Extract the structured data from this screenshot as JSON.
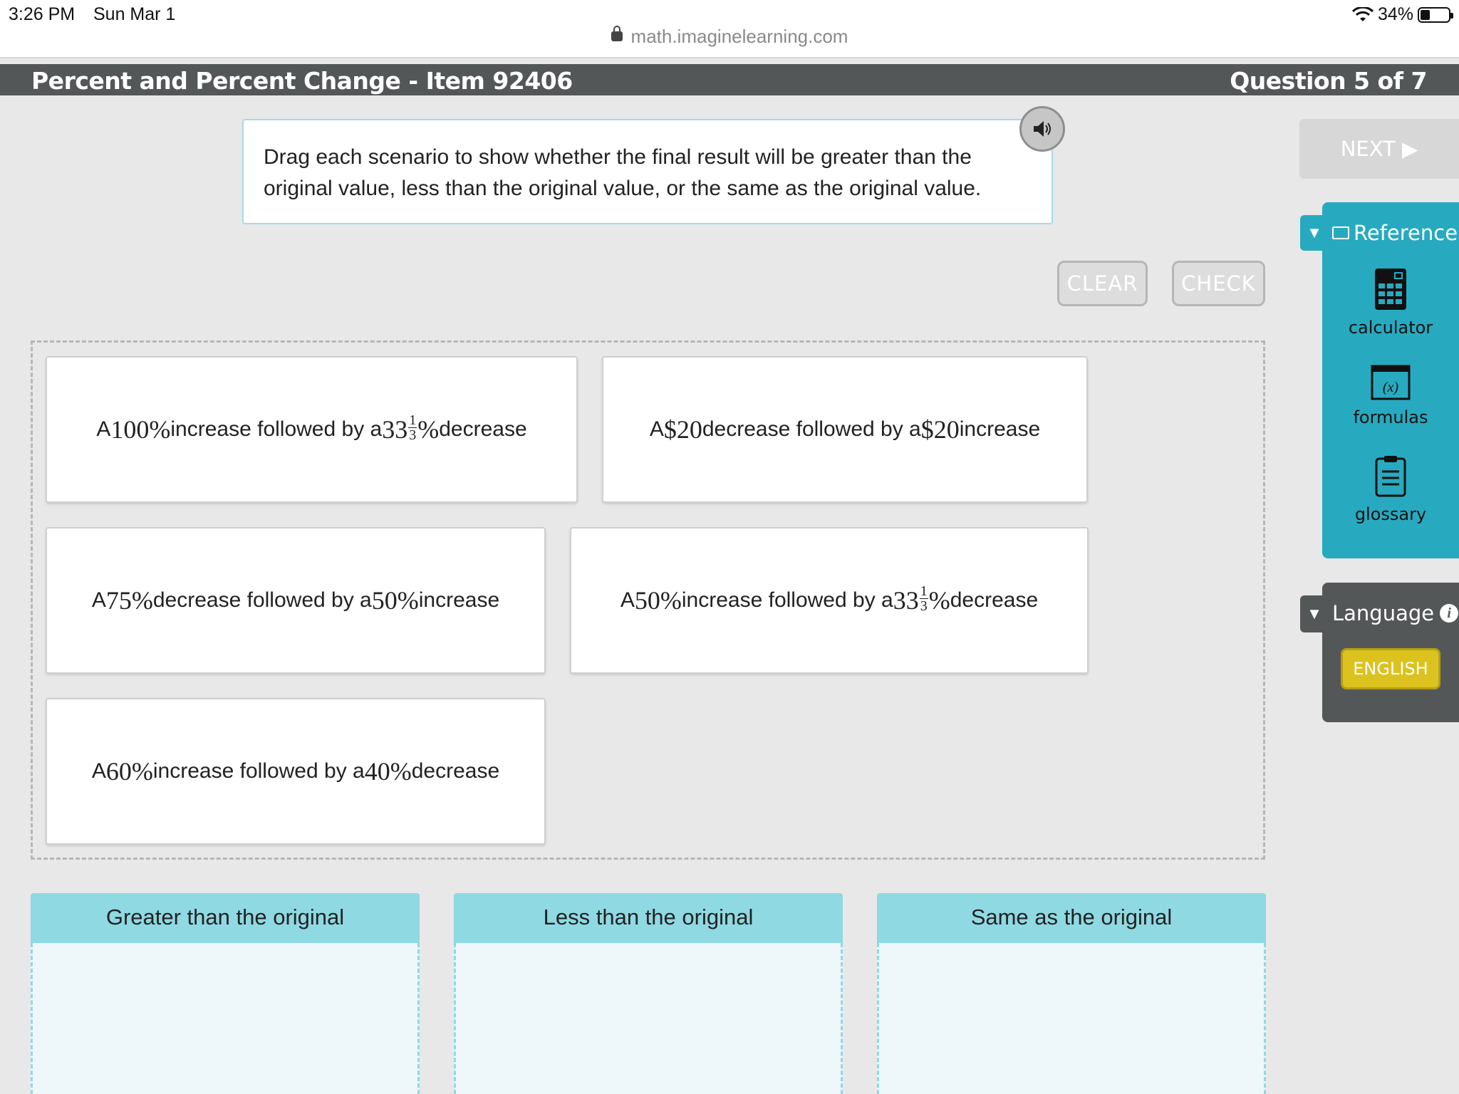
{
  "status": {
    "time": "3:26 PM",
    "date": "Sun Mar 1",
    "battery": "34%",
    "battery_level": 0.34
  },
  "browser": {
    "url": "math.imaginelearning.com"
  },
  "header": {
    "title": "Percent and Percent Change - Item 92406",
    "question": "Question 5 of 7"
  },
  "instruction": "Drag each scenario to show whether the final result will be greater than the original value, less than the original value, or the same as the original value.",
  "buttons": {
    "clear": "CLEAR",
    "check": "CHECK",
    "next": "NEXT ▶"
  },
  "cards": [
    {
      "pre": "A ",
      "a": "100%",
      "mid": " increase followed by a ",
      "b": "33",
      "frac": [
        "1",
        "3"
      ],
      "bsuf": "%",
      "post": " decrease"
    },
    {
      "pre": "A ",
      "a": "$20",
      "mid": " decrease followed by a ",
      "b": "$20",
      "frac": null,
      "bsuf": "",
      "post": " increase"
    },
    {
      "pre": "A ",
      "a": "75%",
      "mid": " decrease followed by a ",
      "b": "50%",
      "frac": null,
      "bsuf": "",
      "post": " increase"
    },
    {
      "pre": "A ",
      "a": "50%",
      "mid": " increase followed by a ",
      "b": "33",
      "frac": [
        "1",
        "3"
      ],
      "bsuf": "%",
      "post": " decrease"
    },
    {
      "pre": "A ",
      "a": "60%",
      "mid": " increase followed by a ",
      "b": "40%",
      "frac": null,
      "bsuf": "",
      "post": " decrease"
    }
  ],
  "buckets": [
    "Greater than the original",
    "Less than the original",
    "Same as the original"
  ],
  "reference": {
    "title": "Reference",
    "items": [
      {
        "label": "calculator",
        "icon": "calculator-icon"
      },
      {
        "label": "formulas",
        "icon": "formulas-icon",
        "glyph": "(x)"
      },
      {
        "label": "glossary",
        "icon": "clipboard-icon"
      }
    ]
  },
  "language": {
    "title": "Language",
    "current": "ENGLISH"
  },
  "colors": {
    "header": "#545758",
    "teal": "#27aac0",
    "bucket": "#8fd9e2",
    "english": "#dcc21e"
  }
}
